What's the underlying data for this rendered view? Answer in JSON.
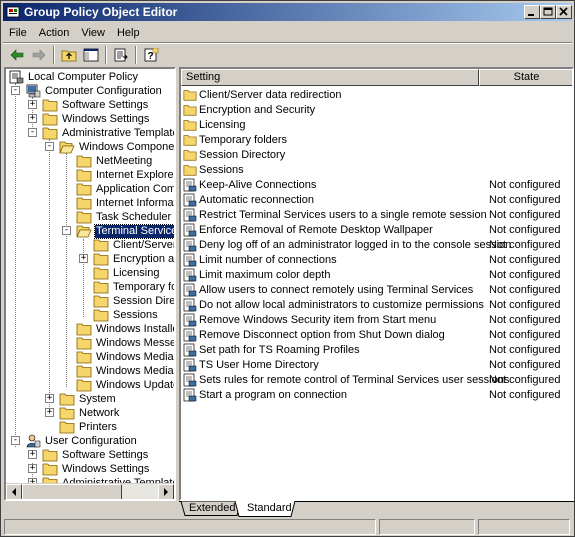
{
  "window": {
    "title": "Group Policy Object Editor"
  },
  "menu": {
    "file": "File",
    "action": "Action",
    "view": "View",
    "help": "Help"
  },
  "tree": {
    "root": "Local Computer Policy",
    "computer_config": "Computer Configuration",
    "cc_software": "Software Settings",
    "cc_windows": "Windows Settings",
    "cc_admin": "Administrative Templates",
    "windows_components": "Windows Components",
    "netmeeting": "NetMeeting",
    "ie": "Internet Explorer",
    "app_compat": "Application Compati",
    "internet_info": "Internet Informatio",
    "task_scheduler": "Task Scheduler",
    "terminal_services": "Terminal Services",
    "ts_client": "Client/Server da",
    "ts_encryption": "Encryption and",
    "ts_licensing": "Licensing",
    "ts_temp": "Temporary folde",
    "ts_session_dir": "Session Director",
    "ts_sessions": "Sessions",
    "windows_installer": "Windows Installer",
    "windows_messenger": "Windows Messenge",
    "windows_media_digi": "Windows Media Digi",
    "windows_media_play": "Windows Media Play",
    "windows_update": "Windows Update",
    "system": "System",
    "network": "Network",
    "printers": "Printers",
    "user_config": "User Configuration",
    "uc_software": "Software Settings",
    "uc_windows": "Windows Settings",
    "uc_admin": "Administrative Templates"
  },
  "list": {
    "col_setting": "Setting",
    "col_state": "State",
    "folders": [
      "Client/Server data redirection",
      "Encryption and Security",
      "Licensing",
      "Temporary folders",
      "Session Directory",
      "Sessions"
    ],
    "settings": [
      {
        "name": "Keep-Alive Connections",
        "state": "Not configured"
      },
      {
        "name": "Automatic reconnection",
        "state": "Not configured"
      },
      {
        "name": "Restrict Terminal Services users to a single remote session",
        "state": "Not configured"
      },
      {
        "name": "Enforce Removal of Remote Desktop Wallpaper",
        "state": "Not configured"
      },
      {
        "name": "Deny log off of an administrator logged in to the console session",
        "state": "Not configured"
      },
      {
        "name": "Limit number of connections",
        "state": "Not configured"
      },
      {
        "name": "Limit maximum color depth",
        "state": "Not configured"
      },
      {
        "name": "Allow users to connect remotely using Terminal Services",
        "state": "Not configured"
      },
      {
        "name": "Do not allow local administrators to customize permissions",
        "state": "Not configured"
      },
      {
        "name": "Remove Windows Security item from Start menu",
        "state": "Not configured"
      },
      {
        "name": "Remove Disconnect option from Shut Down dialog",
        "state": "Not configured"
      },
      {
        "name": "Set path for TS Roaming Profiles",
        "state": "Not configured"
      },
      {
        "name": "TS User Home Directory",
        "state": "Not configured"
      },
      {
        "name": "Sets rules for remote control of Terminal Services user sessions",
        "state": "Not configured"
      },
      {
        "name": "Start a program on connection",
        "state": "Not configured"
      }
    ]
  },
  "tabs": {
    "extended": "Extended",
    "standard": "Standard"
  },
  "colors": {
    "selection": "#0a246a",
    "folder": "#f6d56a",
    "window_face": "#d4d0c8"
  }
}
